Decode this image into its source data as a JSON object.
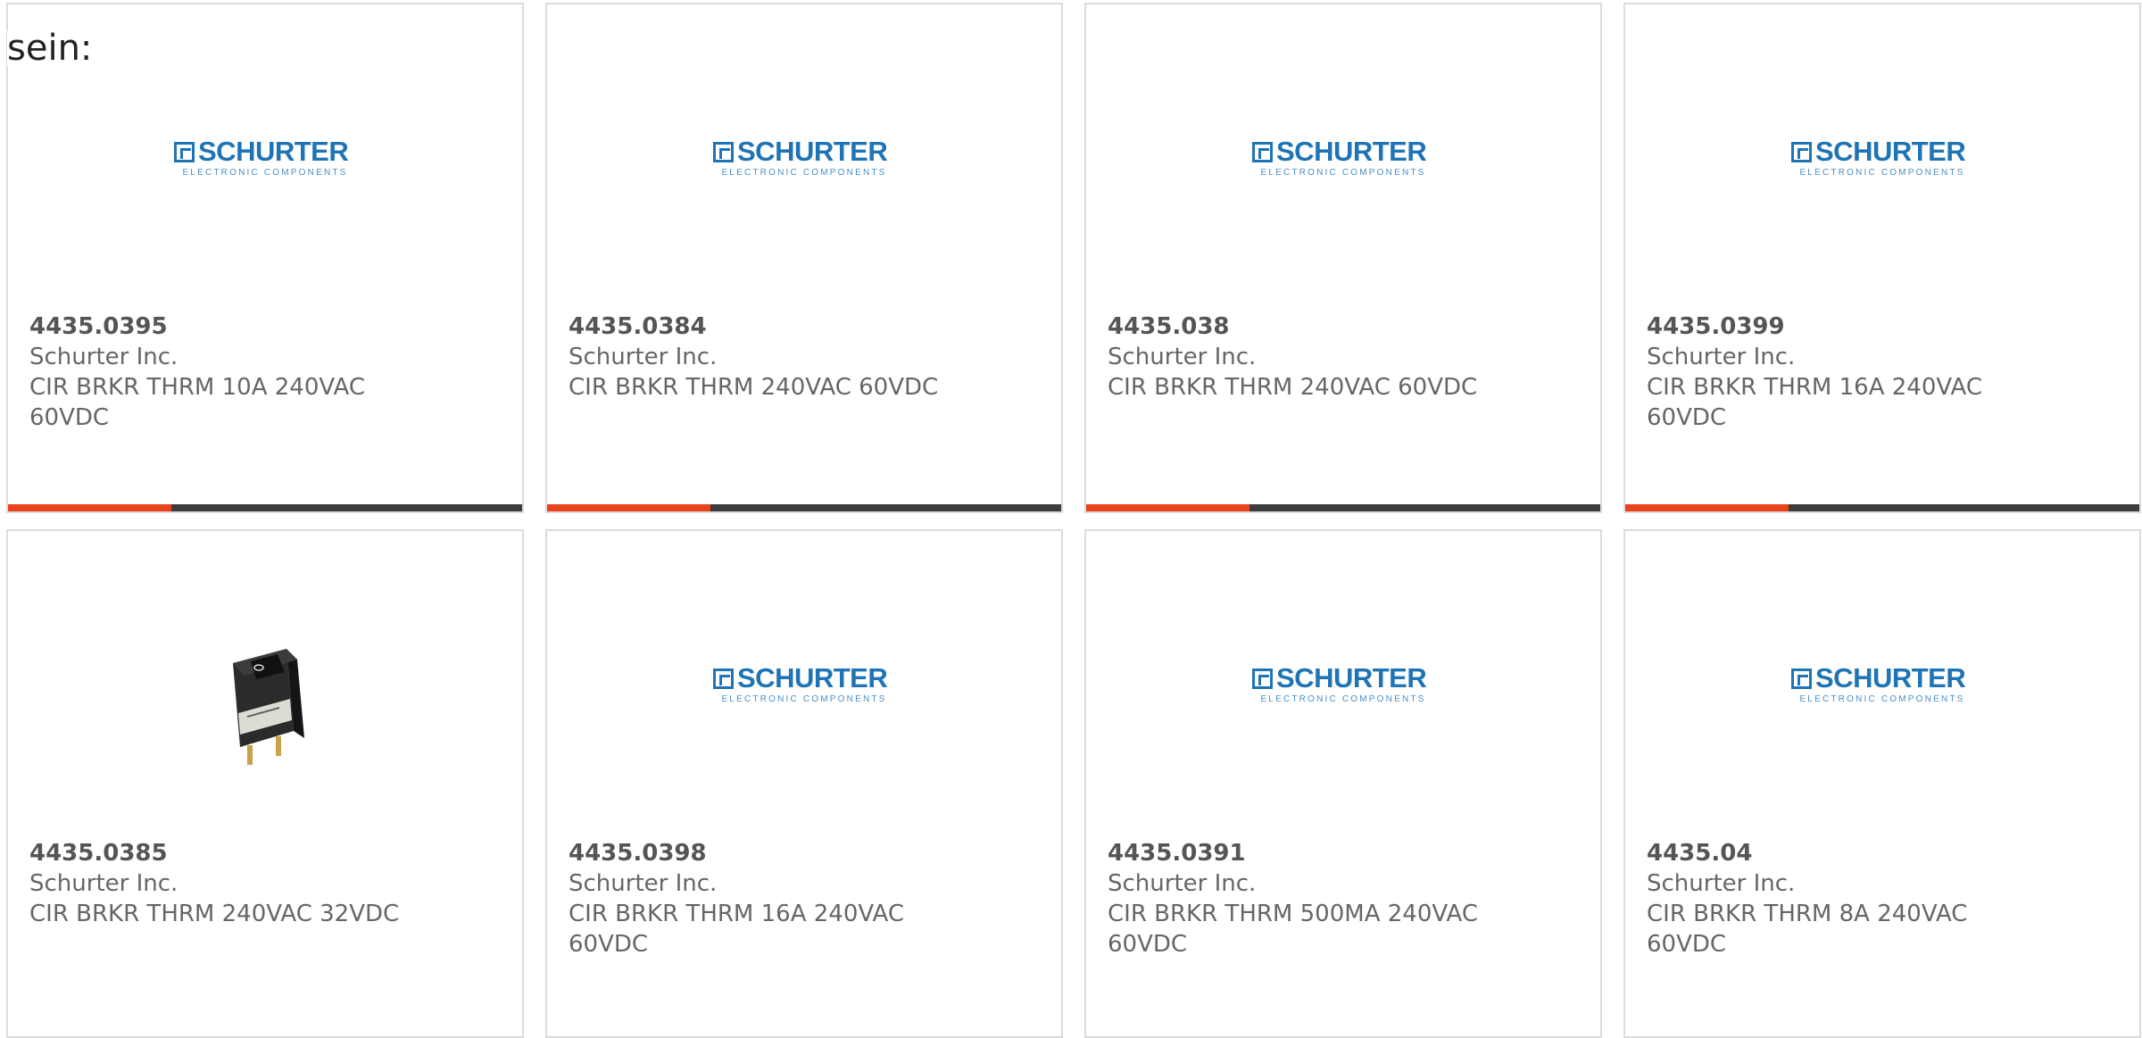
{
  "intro_text": "sein:",
  "logo": {
    "brand": "SCHURTER",
    "tagline": "ELECTRONIC COMPONENTS",
    "brand_color": "#1f74b6"
  },
  "colors": {
    "accent_bar": "#e8431b",
    "bar_base": "#3d3d3d",
    "card_border": "#dcdcdc"
  },
  "products": [
    {
      "part_number": "4435.0395",
      "manufacturer": "Schurter Inc.",
      "description": "CIR BRKR THRM 10A 240VAC 60VDC",
      "image": "schurter-logo"
    },
    {
      "part_number": "4435.0384",
      "manufacturer": "Schurter Inc.",
      "description": "CIR BRKR THRM 240VAC 60VDC",
      "image": "schurter-logo"
    },
    {
      "part_number": "4435.038",
      "manufacturer": "Schurter Inc.",
      "description": "CIR BRKR THRM 240VAC 60VDC",
      "image": "schurter-logo"
    },
    {
      "part_number": "4435.0399",
      "manufacturer": "Schurter Inc.",
      "description": "CIR BRKR THRM 16A 240VAC 60VDC",
      "image": "schurter-logo"
    },
    {
      "part_number": "4435.0385",
      "manufacturer": "Schurter Inc.",
      "description": "CIR BRKR THRM 240VAC 32VDC",
      "image": "rocker-switch-photo"
    },
    {
      "part_number": "4435.0398",
      "manufacturer": "Schurter Inc.",
      "description": "CIR BRKR THRM 16A 240VAC 60VDC",
      "image": "schurter-logo"
    },
    {
      "part_number": "4435.0391",
      "manufacturer": "Schurter Inc.",
      "description": "CIR BRKR THRM 500MA 240VAC 60VDC",
      "image": "schurter-logo"
    },
    {
      "part_number": "4435.04",
      "manufacturer": "Schurter Inc.",
      "description": "CIR BRKR THRM 8A 240VAC 60VDC",
      "image": "schurter-logo"
    }
  ]
}
